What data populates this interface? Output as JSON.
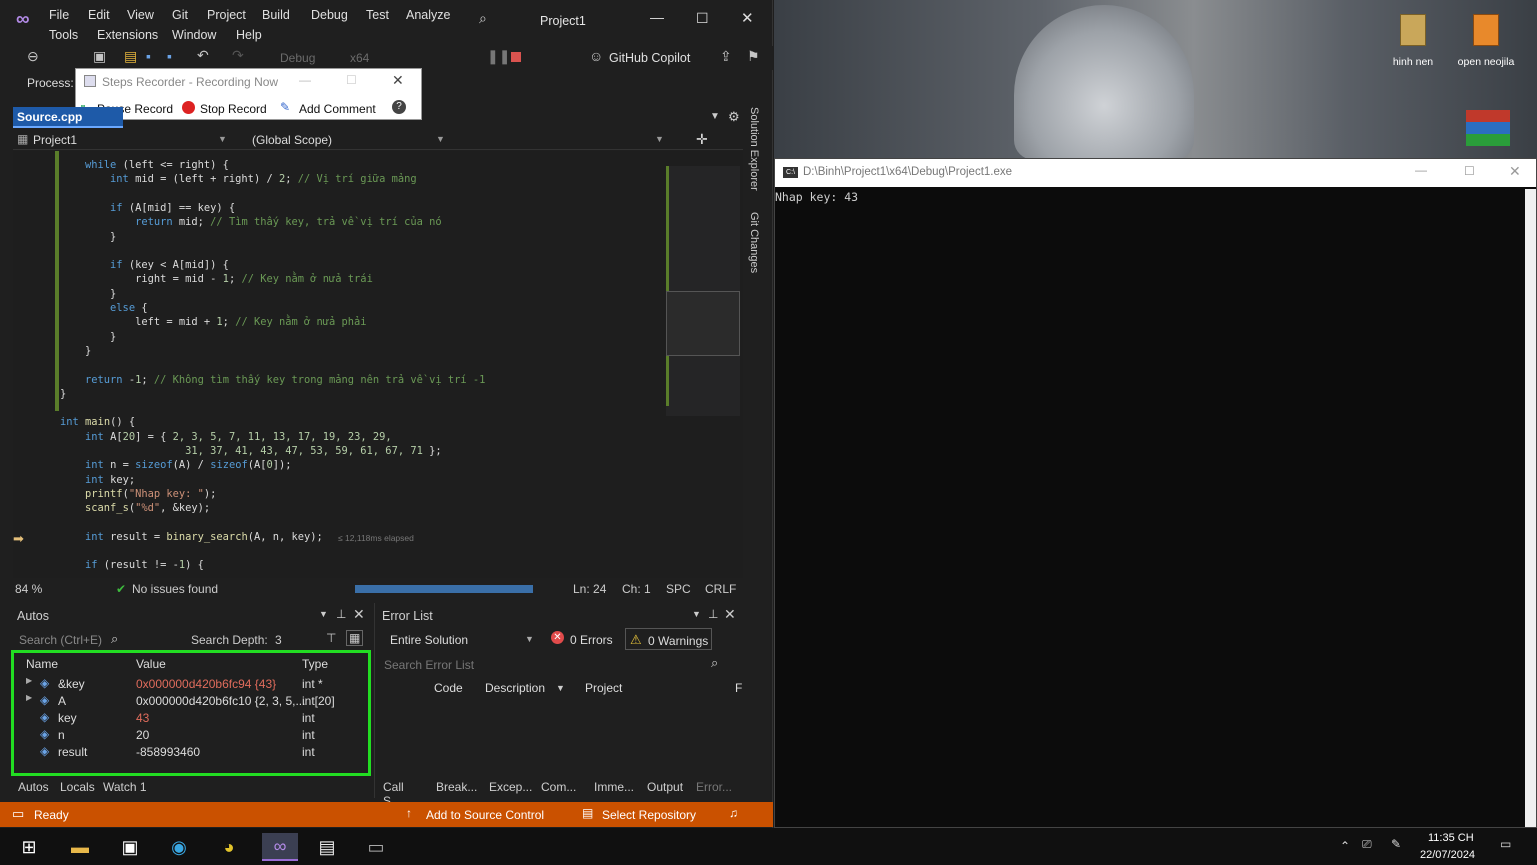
{
  "menu": {
    "file": "File",
    "edit": "Edit",
    "view": "View",
    "git": "Git",
    "project": "Project",
    "build": "Build",
    "debug": "Debug",
    "test": "Test",
    "analyze": "Analyze",
    "tools": "Tools",
    "extensions": "Extensions",
    "window": "Window",
    "help": "Help",
    "title": "Project1"
  },
  "toolbar": {
    "config": "Debug",
    "platform": "x64",
    "copilot": "GitHub Copilot",
    "process_label": "Process:"
  },
  "steps": {
    "title": "Steps Recorder - Recording Now",
    "pause": "Pause Record",
    "stop": "Stop Record",
    "comment": "Add Comment"
  },
  "editor": {
    "tab": "Source.cpp",
    "project_dd": "Project1",
    "scope_dd": "(Global Scope)",
    "zoom": "84 %",
    "issues": "No issues found",
    "ln": "Ln: 24",
    "ch": "Ch: 1",
    "spc": "SPC",
    "crlf": "CRLF",
    "elapsed": "≤ 12,118ms elapsed"
  },
  "side_tabs": {
    "solution_explorer": "Solution Explorer",
    "git_changes": "Git Changes"
  },
  "code": [
    {
      "parts": [
        [
          "kw",
          "while"
        ],
        [
          "p",
          " (left <= right) {"
        ]
      ],
      "indent": "    "
    },
    {
      "parts": [
        [
          "kw",
          "int"
        ],
        [
          "p",
          " mid = (left + right) / "
        ],
        [
          "num",
          "2"
        ],
        [
          "p",
          "; "
        ],
        [
          "cm",
          "// Vị trí giữa mảng"
        ]
      ],
      "indent": "        "
    },
    {
      "parts": [],
      "indent": ""
    },
    {
      "parts": [
        [
          "kw",
          "if"
        ],
        [
          "p",
          " (A[mid] == key) {"
        ]
      ],
      "indent": "        "
    },
    {
      "parts": [
        [
          "kw",
          "return"
        ],
        [
          "p",
          " mid; "
        ],
        [
          "cm",
          "// Tìm thấy key, trả về vị trí của nó"
        ]
      ],
      "indent": "            "
    },
    {
      "parts": [
        [
          "p",
          "}"
        ]
      ],
      "indent": "        "
    },
    {
      "parts": [],
      "indent": ""
    },
    {
      "parts": [
        [
          "kw",
          "if"
        ],
        [
          "p",
          " (key < A[mid]) {"
        ]
      ],
      "indent": "        "
    },
    {
      "parts": [
        [
          "p",
          "right = mid - "
        ],
        [
          "num",
          "1"
        ],
        [
          "p",
          "; "
        ],
        [
          "cm",
          "// Key nằm ở nửa trái"
        ]
      ],
      "indent": "            "
    },
    {
      "parts": [
        [
          "p",
          "}"
        ]
      ],
      "indent": "        "
    },
    {
      "parts": [
        [
          "kw",
          "else"
        ],
        [
          "p",
          " {"
        ]
      ],
      "indent": "        "
    },
    {
      "parts": [
        [
          "p",
          "left = mid + "
        ],
        [
          "num",
          "1"
        ],
        [
          "p",
          "; "
        ],
        [
          "cm",
          "// Key nằm ở nửa phải"
        ]
      ],
      "indent": "            "
    },
    {
      "parts": [
        [
          "p",
          "}"
        ]
      ],
      "indent": "        "
    },
    {
      "parts": [
        [
          "p",
          "}"
        ]
      ],
      "indent": "    "
    },
    {
      "parts": [],
      "indent": ""
    },
    {
      "parts": [
        [
          "kw",
          "return"
        ],
        [
          "p",
          " -"
        ],
        [
          "num",
          "1"
        ],
        [
          "p",
          "; "
        ],
        [
          "cm",
          "// Không tìm thấy key trong mảng nên trả về vị trí -1"
        ]
      ],
      "indent": "    "
    },
    {
      "parts": [
        [
          "p",
          "}"
        ]
      ],
      "indent": ""
    },
    {
      "parts": [],
      "indent": ""
    },
    {
      "parts": [
        [
          "kw",
          "int"
        ],
        [
          "p",
          " "
        ],
        [
          "fn",
          "main"
        ],
        [
          "p",
          "() {"
        ]
      ],
      "indent": ""
    },
    {
      "parts": [
        [
          "kw",
          "int"
        ],
        [
          "p",
          " A["
        ],
        [
          "num",
          "20"
        ],
        [
          "p",
          "] = { "
        ],
        [
          "num",
          "2, 3, 5, 7, 11, 13, 17, 19, 23, 29,"
        ]
      ],
      "indent": "    "
    },
    {
      "parts": [
        [
          "num",
          "31, 37, 41, 43, 47, 53, 59, 61, 67, 71"
        ],
        [
          "p",
          " };"
        ]
      ],
      "indent": "                    "
    },
    {
      "parts": [
        [
          "kw",
          "int"
        ],
        [
          "p",
          " n = "
        ],
        [
          "kw",
          "sizeof"
        ],
        [
          "p",
          "(A) / "
        ],
        [
          "kw",
          "sizeof"
        ],
        [
          "p",
          "(A["
        ],
        [
          "num",
          "0"
        ],
        [
          "p",
          "]);"
        ]
      ],
      "indent": "    "
    },
    {
      "parts": [
        [
          "kw",
          "int"
        ],
        [
          "p",
          " key;"
        ]
      ],
      "indent": "    "
    },
    {
      "parts": [
        [
          "fn",
          "printf"
        ],
        [
          "p",
          "("
        ],
        [
          "str",
          "\"Nhap key: \""
        ],
        [
          "p",
          ");"
        ]
      ],
      "indent": "    "
    },
    {
      "parts": [
        [
          "fn",
          "scanf_s"
        ],
        [
          "p",
          "("
        ],
        [
          "str",
          "\"%d\""
        ],
        [
          "p",
          ", &key);"
        ]
      ],
      "indent": "    "
    },
    {
      "parts": [],
      "indent": ""
    },
    {
      "parts": [
        [
          "kw",
          "int"
        ],
        [
          "p",
          " result = "
        ],
        [
          "fn",
          "binary_search"
        ],
        [
          "p",
          "(A, n, key);"
        ]
      ],
      "indent": "    "
    },
    {
      "parts": [],
      "indent": ""
    },
    {
      "parts": [
        [
          "kw",
          "if"
        ],
        [
          "p",
          " (result != -"
        ],
        [
          "num",
          "1"
        ],
        [
          "p",
          ") {"
        ]
      ],
      "indent": "    "
    }
  ],
  "autos": {
    "title": "Autos",
    "search": "Search (Ctrl+E)",
    "depth_label": "Search Depth:",
    "depth": "3",
    "headers": [
      "Name",
      "Value",
      "Type"
    ],
    "rows": [
      {
        "name": "&key",
        "value": "0x000000d420b6fc94 {43}",
        "type": "int *"
      },
      {
        "name": "A",
        "value": "0x000000d420b6fc10 {2, 3, 5,...",
        "type": "int[20]"
      },
      {
        "name": "key",
        "value": "43",
        "type": "int"
      },
      {
        "name": "n",
        "value": "20",
        "type": "int"
      },
      {
        "name": "result",
        "value": "-858993460",
        "type": "int"
      }
    ],
    "tabs": [
      "Autos",
      "Locals",
      "Watch 1"
    ]
  },
  "errors": {
    "title": "Error List",
    "scope": "Entire Solution",
    "errors": "0 Errors",
    "warnings": "0 Warnings",
    "search": "Search Error List",
    "cols": [
      "Code",
      "Description",
      "Project",
      "F"
    ],
    "tabs": [
      "Call S...",
      "Break...",
      "Excep...",
      "Com...",
      "Imme...",
      "Output",
      "Error..."
    ]
  },
  "status": {
    "ready": "Ready",
    "source_control": "Add to Source Control",
    "repo": "Select Repository"
  },
  "console": {
    "title": "D:\\Binh\\Project1\\x64\\Debug\\Project1.exe",
    "output": "Nhap key: 43"
  },
  "desktop": {
    "icon1": "hinh nen",
    "icon2": "open neojila"
  },
  "clock": {
    "time": "11:35 CH",
    "date": "22/07/2024"
  },
  "colors": {
    "accent": "#9a6ed6",
    "status_bar": "#ca5100",
    "highlight": "#22dd22"
  }
}
